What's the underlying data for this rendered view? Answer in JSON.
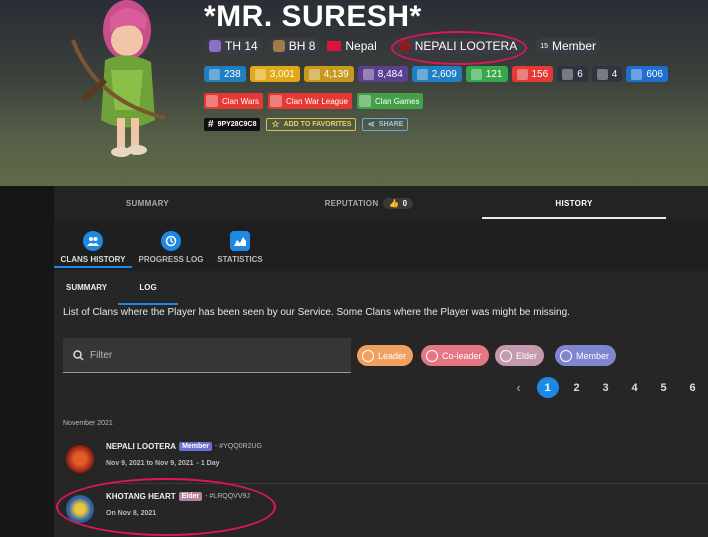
{
  "player": {
    "name": "*MR. SURESH*",
    "tag": "9PY28C9C8"
  },
  "chips": {
    "th": "TH 14",
    "bh": "BH 8",
    "country": "Nepal",
    "clan": "NEPALI LOOTERA",
    "role_prefix": "15",
    "role": "Member"
  },
  "stats": [
    {
      "value": "238",
      "color": "#1f7fc1",
      "icon": "xp-icon"
    },
    {
      "value": "3,001",
      "color": "#e0a915",
      "icon": "star-icon"
    },
    {
      "value": "4,139",
      "color": "#c79a1d",
      "icon": "trophy-icon"
    },
    {
      "value": "8,484",
      "color": "#5b3f93",
      "icon": "builder-trophy-icon"
    },
    {
      "value": "2,609",
      "color": "#1e7fc5",
      "icon": "best-trophy-icon"
    },
    {
      "value": "121",
      "color": "#37a84a",
      "icon": "arrow-up-icon"
    },
    {
      "value": "156",
      "color": "#e53935",
      "icon": "arrow-down-icon"
    },
    {
      "value": "6",
      "color": "#2e3340",
      "icon": "swords-icon"
    },
    {
      "value": "4",
      "color": "#2e3340",
      "icon": "shield-icon"
    },
    {
      "value": "606",
      "color": "#1f6fd1",
      "icon": "attack-icon"
    }
  ],
  "achievements": [
    {
      "label": "Clan Wars",
      "color": "#e53935"
    },
    {
      "label": "Clan War League",
      "color": "#e53935"
    },
    {
      "label": "Clan Games",
      "color": "#43a047"
    }
  ],
  "actions": {
    "add_favorites": "ADD TO FAVORITES",
    "share": "SHARE"
  },
  "tabs": {
    "summary": "SUMMARY",
    "reputation": "REPUTATION",
    "reputation_count": "0",
    "history": "HISTORY"
  },
  "subtabs": {
    "clans_history": "CLANS HISTORY",
    "progress_log": "PROGRESS LOG",
    "statistics": "STATISTICS"
  },
  "segments": {
    "summary": "SUMMARY",
    "log": "LOG"
  },
  "description": "List of Clans where the Player has been seen by our Service. Some Clans where the Player was might be missing.",
  "filter": {
    "placeholder": "Filter"
  },
  "roles": [
    {
      "label": "Leader",
      "color": "#f0a160"
    },
    {
      "label": "Co-leader",
      "color": "#e57684"
    },
    {
      "label": "Elder",
      "color": "#c49aae"
    },
    {
      "label": "Member",
      "color": "#7f85cf"
    }
  ],
  "pagination": {
    "pages": [
      "1",
      "2",
      "3",
      "4",
      "5",
      "6"
    ],
    "current": "1"
  },
  "history": {
    "month": "November 2021",
    "entries": [
      {
        "name": "NEPALI LOOTERA",
        "role": "Member",
        "role_color": "#6a6fd0",
        "tag": "- #YQQ0R2UG",
        "dates": "Nov 9, 2021 to Nov 9, 2021",
        "duration": "- 1 Day"
      },
      {
        "name": "KHOTANG HEART",
        "role": "Elder",
        "role_color": "#b7829f",
        "tag": "- #LRQQVV9J",
        "dates": "On Nov 8, 2021",
        "duration": ""
      }
    ]
  },
  "colors": {
    "highlight": "#e0155c",
    "accent": "#1e88e5"
  }
}
